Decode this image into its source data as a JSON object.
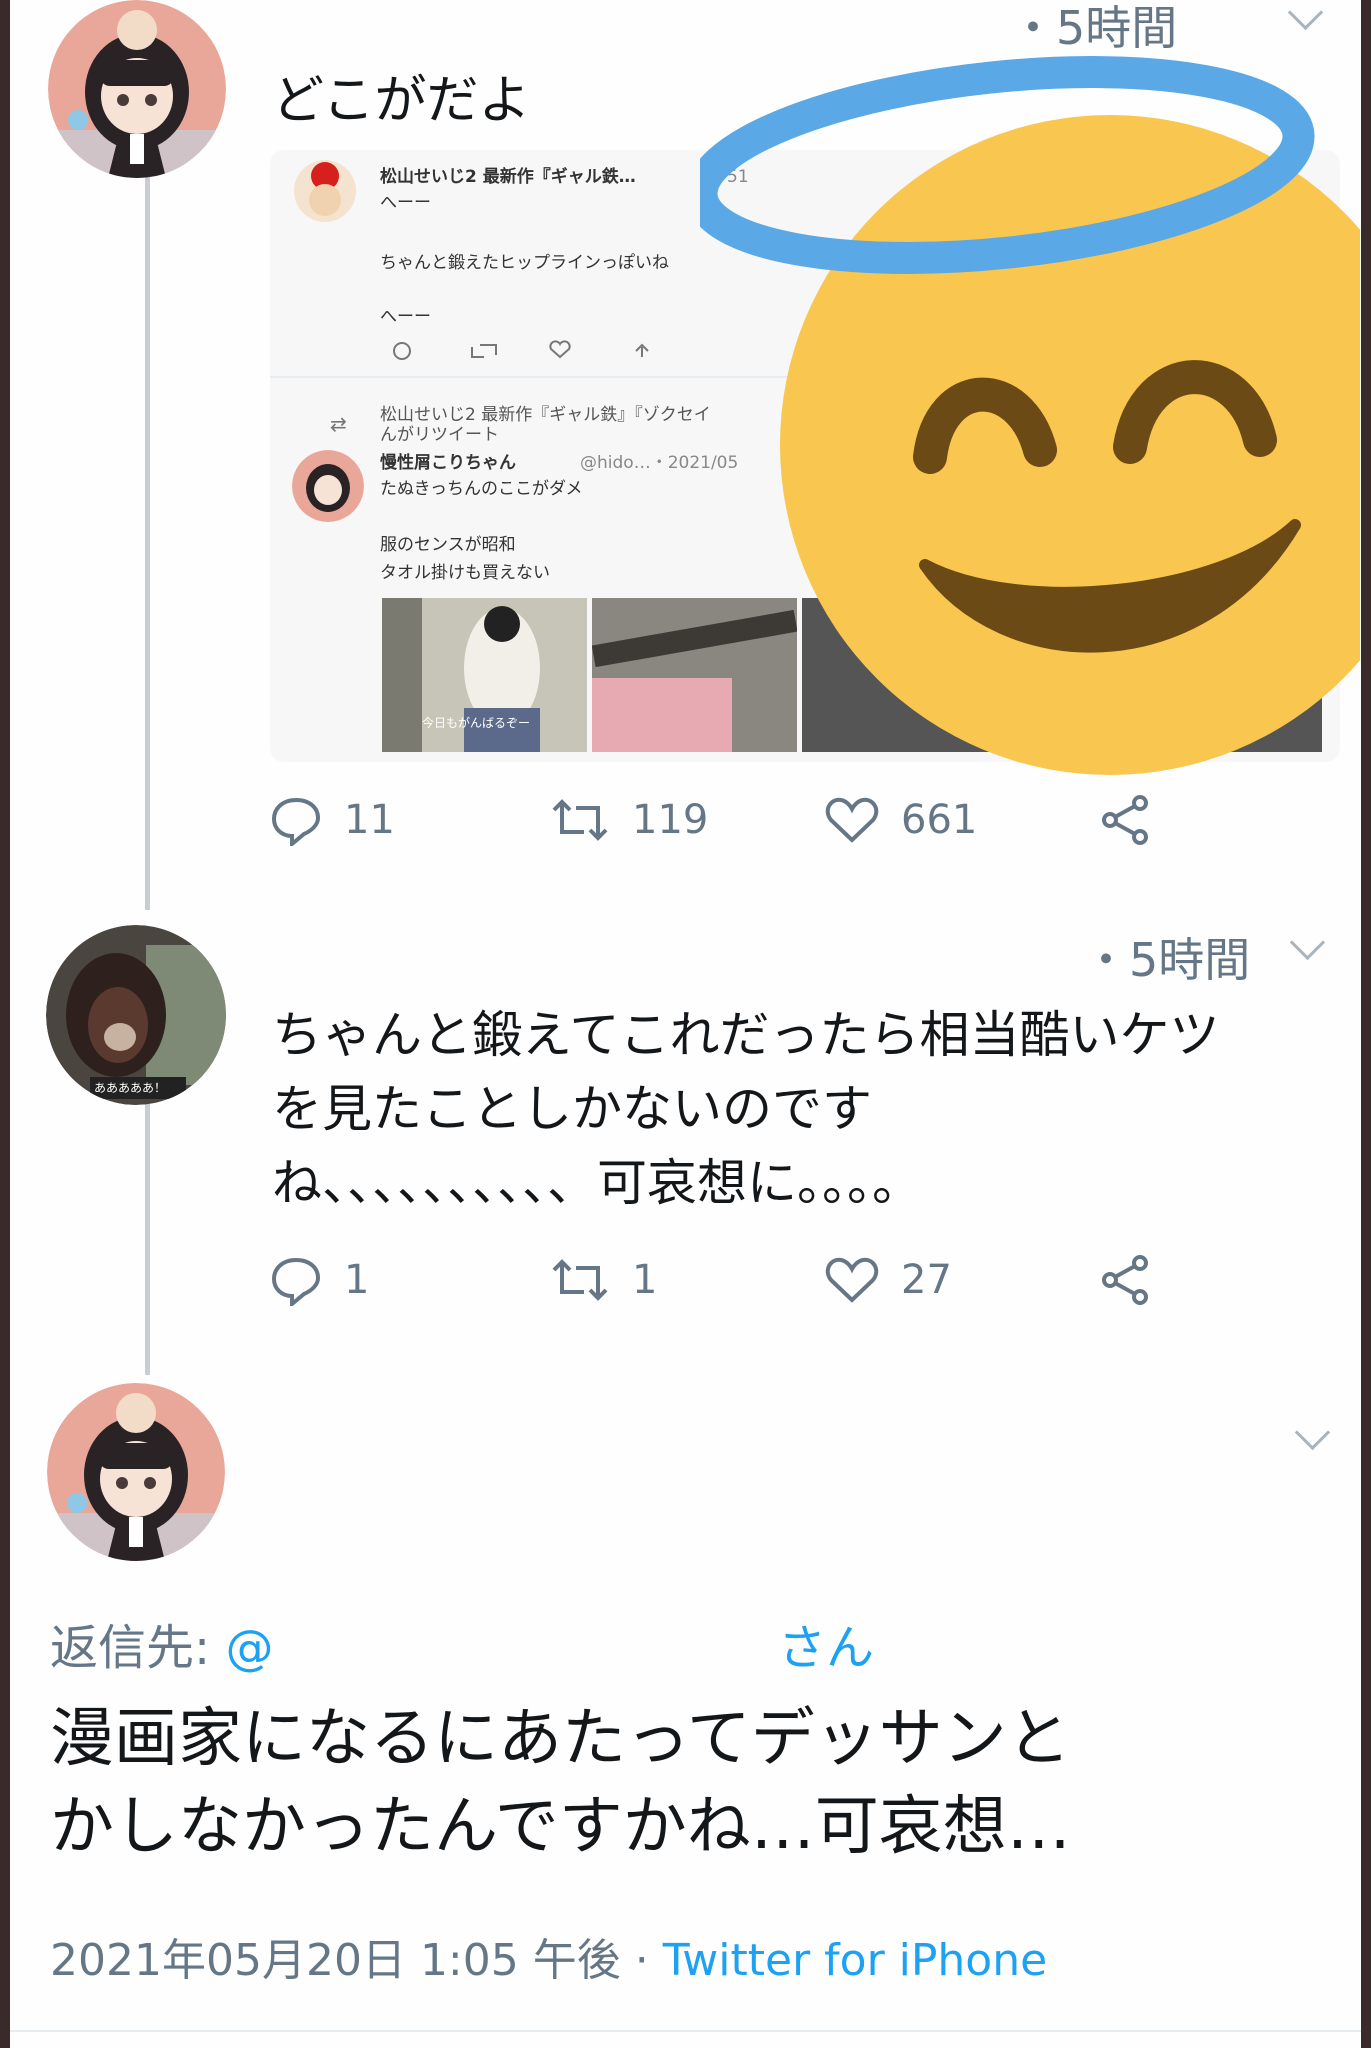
{
  "colors": {
    "link": "#1da1f2",
    "text": "#14171a",
    "grey": "#657786",
    "halo": "#5aa8e6",
    "face": "#f9c64f",
    "features": "#6b4a15"
  },
  "tweet1": {
    "time": "・5時間",
    "text": "どこがだよ",
    "embedded": {
      "quote_author": "松山せいじ2 最新作『ギャル鉄…",
      "quote_time": "・51",
      "quote_line1": "へーー",
      "quote_line2": "ちゃんと鍛えたヒップラインっぽいね",
      "quote_line3": "へーー",
      "retweet_label": "松山せいじ2 最新作『ギャル鉄』『ゾクセイ",
      "retweet_label2": "んがリツイート",
      "inner_author": "慢性屑こりちゃん",
      "inner_handle": "@hido…・2021/05",
      "inner_line1": "たぬきっちんのここがダメ",
      "inner_line2": "服のセンスが昭和",
      "inner_line3": "タオル掛けも買えない",
      "photo_caption": "今日もがんばるぞー"
    },
    "replies": "11",
    "retweets": "119",
    "likes": "661"
  },
  "tweet2": {
    "time": "・5時間",
    "text_line1": "ちゃんと鍛えてこれだったら相当酷いケツ",
    "text_line2": "を見たことしかないのです",
    "text_line3": "ね、、、、、、、、、、可哀想に。。。。",
    "avatar_caption": "あああああ！",
    "replies": "1",
    "retweets": "1",
    "likes": "27"
  },
  "tweet3": {
    "reply_to_label": "返信先:",
    "reply_to_at": "@",
    "reply_to_san": "さん",
    "text_line1": "漫画家になるにあたってデッサンと",
    "text_line2": "かしなかったんですかね…可哀想…",
    "timestamp": "2021年05月20日 1:05 午後",
    "dot": " · ",
    "client": "Twitter for iPhone"
  },
  "icons": [
    "reply-icon",
    "retweet-icon",
    "like-icon",
    "share-icon",
    "chevron-down-icon",
    "smiling-face-with-halo-emoji"
  ]
}
